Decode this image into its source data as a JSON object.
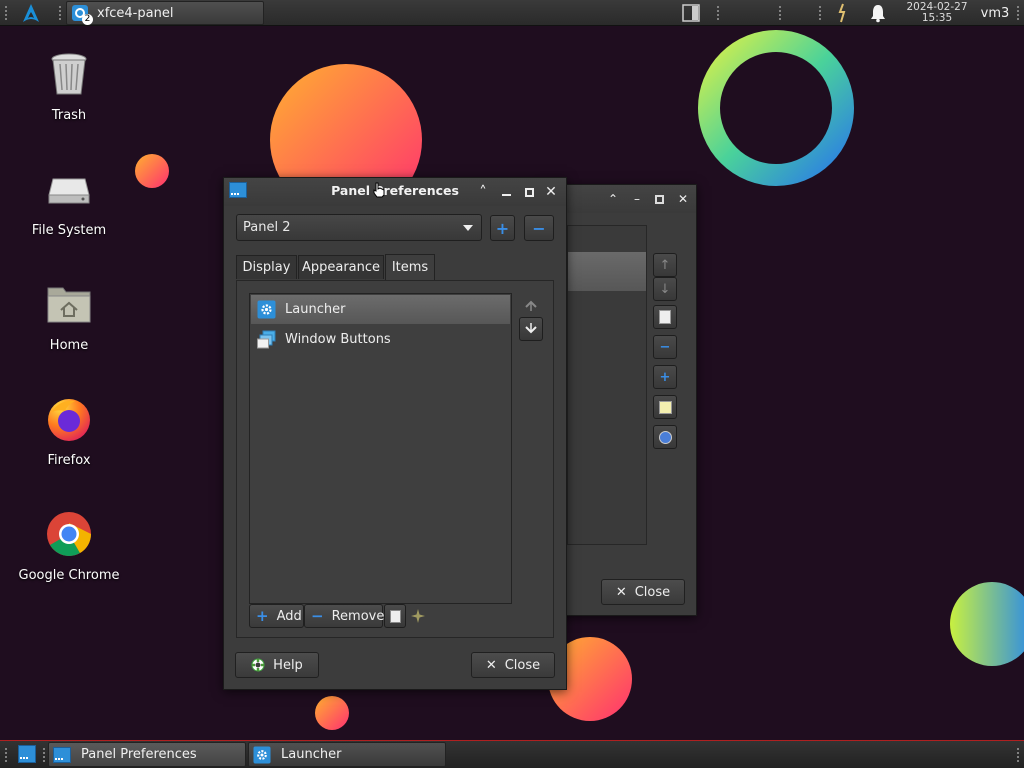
{
  "top_panel": {
    "task_title": "xfce4-panel",
    "task_badge": "2",
    "clock_date": "2024-02-27",
    "clock_time": "15:35",
    "hostname": "vm3"
  },
  "desktop_icons": [
    {
      "label": "Trash",
      "icon": "trash-icon"
    },
    {
      "label": "File System",
      "icon": "drive-icon"
    },
    {
      "label": "Home",
      "icon": "home-folder-icon"
    },
    {
      "label": "Firefox",
      "icon": "firefox-icon"
    },
    {
      "label": "Google Chrome",
      "icon": "chrome-icon"
    }
  ],
  "dialog": {
    "title": "Panel Preferences",
    "panel_select": "Panel 2",
    "tabs": [
      "Display",
      "Appearance",
      "Items"
    ],
    "active_tab": "Items",
    "items": [
      {
        "label": "Launcher",
        "icon": "launcher-gear-icon",
        "selected": true
      },
      {
        "label": "Window Buttons",
        "icon": "window-buttons-icon",
        "selected": false
      }
    ],
    "add_label": "Add",
    "remove_label": "Remove",
    "help_label": "Help",
    "close_label": "Close"
  },
  "back_window": {
    "close_label": "Close"
  },
  "bottom_panel": {
    "tasks": [
      {
        "label": "Panel Preferences",
        "icon": "panel-prefs-icon"
      },
      {
        "label": "Launcher",
        "icon": "launcher-gear-icon"
      }
    ]
  },
  "colors": {
    "desktop": "#1f0d1f",
    "accent_blue": "#3a8ee6",
    "bottom_border": "#b02020"
  }
}
